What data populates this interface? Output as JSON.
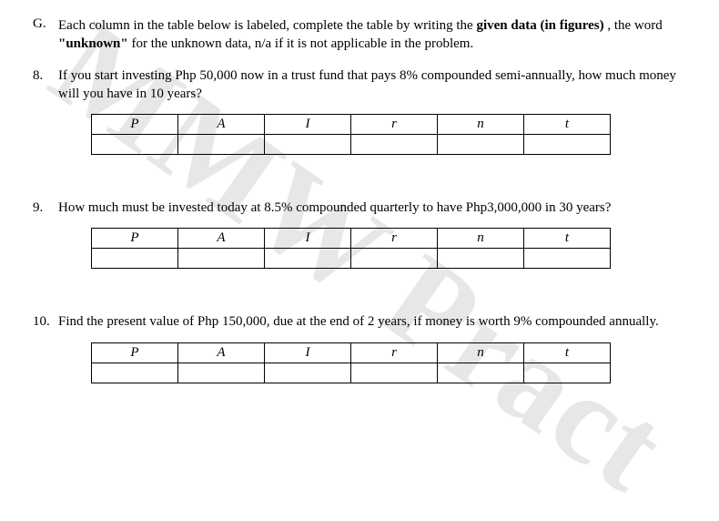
{
  "watermark": "MMW Pract",
  "sectionG": {
    "letter": "G.",
    "text_before_bold1": "Each column in the table below is labeled, complete the table by writing the ",
    "bold1": "given data (in figures)",
    "text_mid": ", the word ",
    "bold2": "\"unknown\"",
    "text_after": " for the unknown data, n/a if it is not applicable in the problem."
  },
  "headers": [
    "P",
    "A",
    "I",
    "r",
    "n",
    "t"
  ],
  "problems": [
    {
      "num": "8.",
      "text": "If you start investing Php 50,000 now in a trust fund that pays 8% compounded semi-annually, how much money will you have in 10 years?",
      "answers": [
        "",
        "",
        "",
        "",
        "",
        ""
      ]
    },
    {
      "num": "9.",
      "text": "How much must be invested today at 8.5% compounded quarterly to have Php3,000,000 in 30 years?",
      "answers": [
        "",
        "",
        "",
        "",
        "",
        ""
      ]
    },
    {
      "num": "10.",
      "text": "Find the present value of Php 150,000, due at the end of 2 years, if money is worth 9% compounded annually.",
      "answers": [
        "",
        "",
        "",
        "",
        "",
        ""
      ]
    }
  ]
}
